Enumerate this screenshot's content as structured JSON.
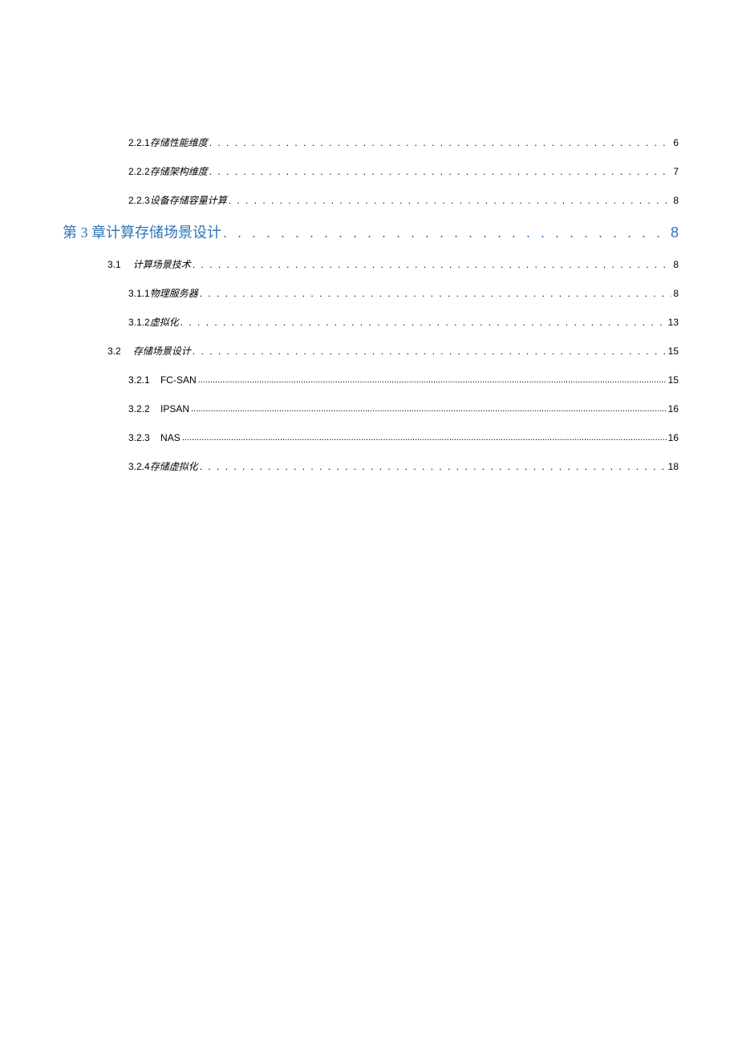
{
  "toc": [
    {
      "type": "l3",
      "num": "2.2.1",
      "title": "存储性能维度",
      "style": "italic",
      "leader": "dots",
      "page": "6"
    },
    {
      "type": "l3",
      "num": "2.2.2",
      "title": "存储架构维度",
      "style": "italic",
      "leader": "dots",
      "page": "7"
    },
    {
      "type": "l3",
      "num": "2.2.3",
      "title": "设备存储容量计算",
      "style": "italic",
      "leader": "dots",
      "page": "8"
    },
    {
      "type": "chapter",
      "title": "第 3 章计算存储场景设计",
      "leader": "bigdots",
      "page": "8"
    },
    {
      "type": "l2",
      "num": "3.1",
      "title": "计算场景技术",
      "style": "italic",
      "leader": "dots",
      "page": "8"
    },
    {
      "type": "l3",
      "num": "3.1.1",
      "title": "物理服务器",
      "style": "italic",
      "leader": "dots",
      "page": "8"
    },
    {
      "type": "l3",
      "num": "3.1.2",
      "title": "虚拟化",
      "style": "italic",
      "leader": "dots",
      "page": "13"
    },
    {
      "type": "l2",
      "num": "3.2",
      "title": "存储场景设计",
      "style": "italic",
      "leader": "dots",
      "page": "15"
    },
    {
      "type": "l3",
      "num": "3.2.1",
      "title": "FC-SAN",
      "style": "sans",
      "leader": "fine",
      "page": "15"
    },
    {
      "type": "l3",
      "num": "3.2.2",
      "title": "IPSAN",
      "style": "sans",
      "leader": "fine",
      "page": "16"
    },
    {
      "type": "l3",
      "num": "3.2.3",
      "title": "NAS",
      "style": "sans",
      "leader": "fine",
      "page": "16"
    },
    {
      "type": "l3",
      "num": "3.2.4",
      "title": "存储虚拟化",
      "style": "italic",
      "leader": "dots",
      "page": "18"
    }
  ]
}
